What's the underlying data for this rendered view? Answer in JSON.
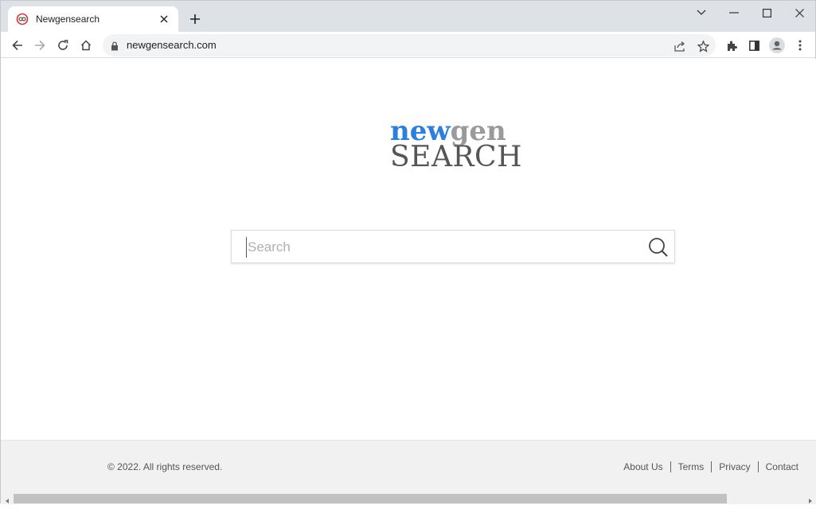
{
  "browser": {
    "tab": {
      "title": "Newgensearch",
      "favicon": "newgen-favicon-icon",
      "close_icon": "close-icon"
    },
    "new_tab_icon": "plus-icon",
    "window_controls": [
      "chevron-down-icon",
      "minimize-icon",
      "maximize-icon",
      "close-icon"
    ],
    "nav": [
      "back-icon",
      "forward-icon",
      "reload-icon",
      "home-icon"
    ],
    "address": {
      "url": "newgensearch.com",
      "lock_icon": "lock-icon"
    },
    "omnibox_icons": [
      "share-icon",
      "bookmark-star-icon"
    ],
    "toolbar_icons": [
      "extensions-icon",
      "side-panel-icon",
      "profile-icon",
      "menu-icon"
    ]
  },
  "page": {
    "logo": {
      "line1_part1": "new",
      "line1_part2": "gen",
      "line2": "SEARCH"
    },
    "search": {
      "placeholder": "Search",
      "value": "",
      "button_icon": "search-icon"
    },
    "footer": {
      "copyright": "© 2022. All rights reserved.",
      "links": [
        "About Us",
        "Terms",
        "Privacy",
        "Contact"
      ]
    }
  },
  "colors": {
    "brand_blue": "#2c7fe0",
    "brand_gray": "#9a9a9a",
    "logo_dark": "#555555"
  }
}
